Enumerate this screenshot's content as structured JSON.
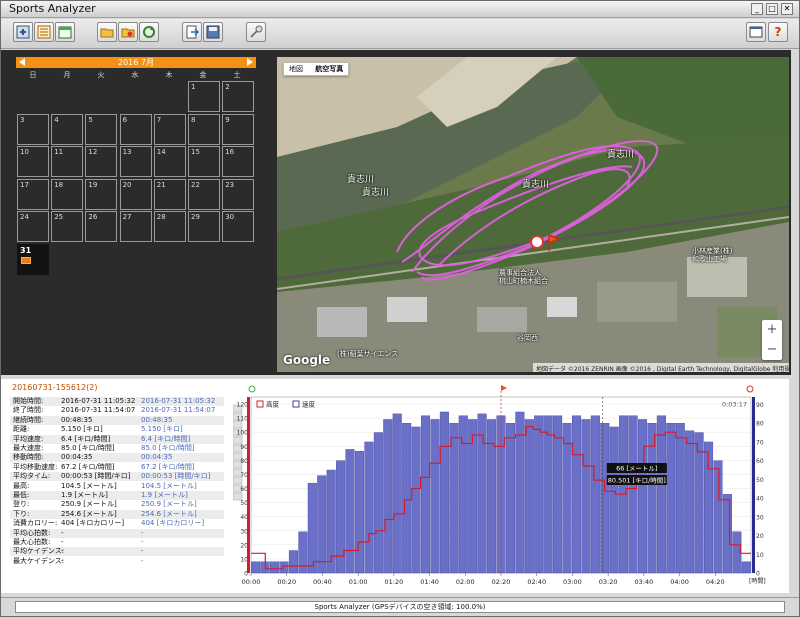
{
  "app": {
    "title": "Sports Analyzer",
    "win_min": "_",
    "win_max": "□",
    "win_close": "✕"
  },
  "toolbar": {
    "buttons": [
      {
        "icon": "import-icon"
      },
      {
        "icon": "list-icon"
      },
      {
        "icon": "calendar-icon"
      },
      {
        "icon": "folder-open-icon"
      },
      {
        "icon": "folder-save-icon"
      },
      {
        "icon": "refresh-icon"
      },
      {
        "icon": "export-icon"
      },
      {
        "icon": "save-icon"
      },
      {
        "icon": "settings-icon"
      }
    ],
    "right": [
      {
        "icon": "window-icon"
      },
      {
        "icon": "help-icon",
        "label": "?"
      }
    ]
  },
  "calendar": {
    "month": "2016 7月",
    "weekdays": [
      "日",
      "月",
      "火",
      "水",
      "木",
      "金",
      "土"
    ],
    "days": [
      "1",
      "2",
      "3",
      "4",
      "5",
      "6",
      "7",
      "8",
      "9",
      "10",
      "11",
      "12",
      "13",
      "14",
      "15",
      "16",
      "17",
      "18",
      "19",
      "20",
      "21",
      "22",
      "23",
      "24",
      "25",
      "26",
      "27",
      "28",
      "29",
      "30",
      "31"
    ],
    "selected_day": "31",
    "colors": {
      "header": "#f49014",
      "background": "#2b2b2b"
    }
  },
  "map": {
    "type_buttons": [
      "地図",
      "航空写真"
    ],
    "labels": [
      "貴志川",
      "貴志川",
      "貴志川",
      "貴志川",
      "農事組合法人\n桃山町楠木組合",
      "(株)稲葉サイエンス",
      "小林産業(株)\n和歌山工場",
      "谷岡西"
    ],
    "google": "Google",
    "attribution": "地図データ ©2016 ZENRIN 画像 ©2016 , Digital Earth Technology, DigitalGlobe   利用規約",
    "zoom_in": "+",
    "zoom_out": "−",
    "track_color": "#e060e0"
  },
  "info": {
    "session": "20160731-155612(2)",
    "rows": [
      {
        "k": "開始時間:",
        "v": "2016-07-31 11:05:32",
        "v2": "2016-07-31 11:05:32"
      },
      {
        "k": "終了時間:",
        "v": "2016-07-31 11:54:07",
        "v2": "2016-07-31 11:54:07"
      },
      {
        "k": "継続時間:",
        "v": "00:48:35",
        "v2": "00:48:35"
      },
      {
        "k": "距離:",
        "v": "5.150 [キロ]",
        "v2": "5.150 [キロ]"
      },
      {
        "k": "平均速度:",
        "v": "6.4 [キロ/時間]",
        "v2": "6.4 [キロ/時間]"
      },
      {
        "k": "最大速度:",
        "v": "85.0 [キロ/時間]",
        "v2": "85.0 [キロ/時間]"
      },
      {
        "k": "移動時間:",
        "v": "00:04:35",
        "v2": "00:04:35"
      },
      {
        "k": "平均移動速度:",
        "v": "67.2 [キロ/時間]",
        "v2": "67.2 [キロ/時間]"
      },
      {
        "k": "平均タイム:",
        "v": "00:00:53 [時間/キロ]",
        "v2": "00:00:53 [時間/キロ]"
      },
      {
        "k": "最高:",
        "v": "104.5 [メートル]",
        "v2": "104.5 [メートル]"
      },
      {
        "k": "最低:",
        "v": "1.9 [メートル]",
        "v2": "1.9 [メートル]"
      },
      {
        "k": "登り:",
        "v": "250.9 [メートル]",
        "v2": "250.9 [メートル]"
      },
      {
        "k": "下り:",
        "v": "254.6 [メートル]",
        "v2": "254.6 [メートル]"
      },
      {
        "k": "消費カロリー:",
        "v": "404 [キロカロリー]",
        "v2": "404 [キロカロリー]"
      },
      {
        "k": "平均心拍数:",
        "v": "-",
        "v2": "-"
      },
      {
        "k": "最大心拍数:",
        "v": "-",
        "v2": "-"
      },
      {
        "k": "平均ケイデンス:",
        "v": "-",
        "v2": "-"
      },
      {
        "k": "最大ケイデンス:",
        "v": "-",
        "v2": "-"
      }
    ]
  },
  "chart_data": {
    "type": "bar",
    "legend": [
      "高度",
      "速度"
    ],
    "time_readout": "0:03:17",
    "x_ticks": [
      "00:00",
      "00:20",
      "00:40",
      "01:00",
      "01:20",
      "01:40",
      "02:00",
      "02:20",
      "02:40",
      "03:00",
      "03:20",
      "03:40",
      "04:00",
      "04:20"
    ],
    "x_unit": "[時間]",
    "y_left_ticks": [
      "0",
      "10",
      "20",
      "30",
      "40",
      "50",
      "60",
      "70",
      "80",
      "90",
      "100",
      "110",
      "120"
    ],
    "y_right_ticks": [
      "0",
      "10",
      "20",
      "30",
      "40",
      "50",
      "60",
      "70",
      "80",
      "90"
    ],
    "ylim_left": [
      0,
      125
    ],
    "ylim_right": [
      0,
      94
    ],
    "x_max_seconds": 280,
    "bar_width_seconds": 4.5,
    "speed_bars": [
      6,
      6,
      6,
      6,
      12,
      22,
      48,
      52,
      55,
      60,
      66,
      65,
      70,
      75,
      82,
      85,
      80,
      78,
      84,
      82,
      86,
      80,
      84,
      82,
      85,
      82,
      84,
      80,
      86,
      82,
      84,
      84,
      84,
      80,
      84,
      82,
      84,
      80,
      78,
      84,
      84,
      82,
      80,
      84,
      80,
      80,
      76,
      75,
      70,
      60,
      42,
      22,
      6
    ],
    "altitude": [
      [
        0,
        14
      ],
      [
        5,
        14
      ],
      [
        8,
        3
      ],
      [
        18,
        5
      ],
      [
        28,
        5
      ],
      [
        35,
        8
      ],
      [
        45,
        12
      ],
      [
        52,
        16
      ],
      [
        60,
        22
      ],
      [
        66,
        28
      ],
      [
        70,
        30
      ],
      [
        75,
        38
      ],
      [
        80,
        42
      ],
      [
        86,
        52
      ],
      [
        90,
        60
      ],
      [
        95,
        68
      ],
      [
        100,
        78
      ],
      [
        106,
        90
      ],
      [
        112,
        96
      ],
      [
        118,
        92
      ],
      [
        124,
        98
      ],
      [
        130,
        92
      ],
      [
        136,
        90
      ],
      [
        142,
        96
      ],
      [
        148,
        98
      ],
      [
        154,
        104
      ],
      [
        158,
        102
      ],
      [
        162,
        100
      ],
      [
        166,
        98
      ],
      [
        170,
        96
      ],
      [
        175,
        92
      ],
      [
        180,
        84
      ],
      [
        186,
        76
      ],
      [
        192,
        66
      ],
      [
        198,
        58
      ],
      [
        204,
        56
      ],
      [
        210,
        60
      ],
      [
        216,
        74
      ],
      [
        220,
        90
      ],
      [
        226,
        98
      ],
      [
        232,
        100
      ],
      [
        238,
        96
      ],
      [
        244,
        92
      ],
      [
        250,
        86
      ],
      [
        256,
        74
      ],
      [
        262,
        52
      ],
      [
        268,
        20
      ],
      [
        274,
        14
      ],
      [
        280,
        14
      ]
    ],
    "cursor_time_label": "66 [メートル]",
    "cursor_speed_label": "80.501 [キロ/時間]",
    "colors": {
      "altitude": "#d41c2c",
      "speed": "#6a70c8",
      "speed_edge": "#40449a",
      "speed_axis": "#2b2b8a"
    }
  },
  "status": {
    "text": "Sports Analyzer (GPSデバイスの空き領域: 100.0%)"
  }
}
